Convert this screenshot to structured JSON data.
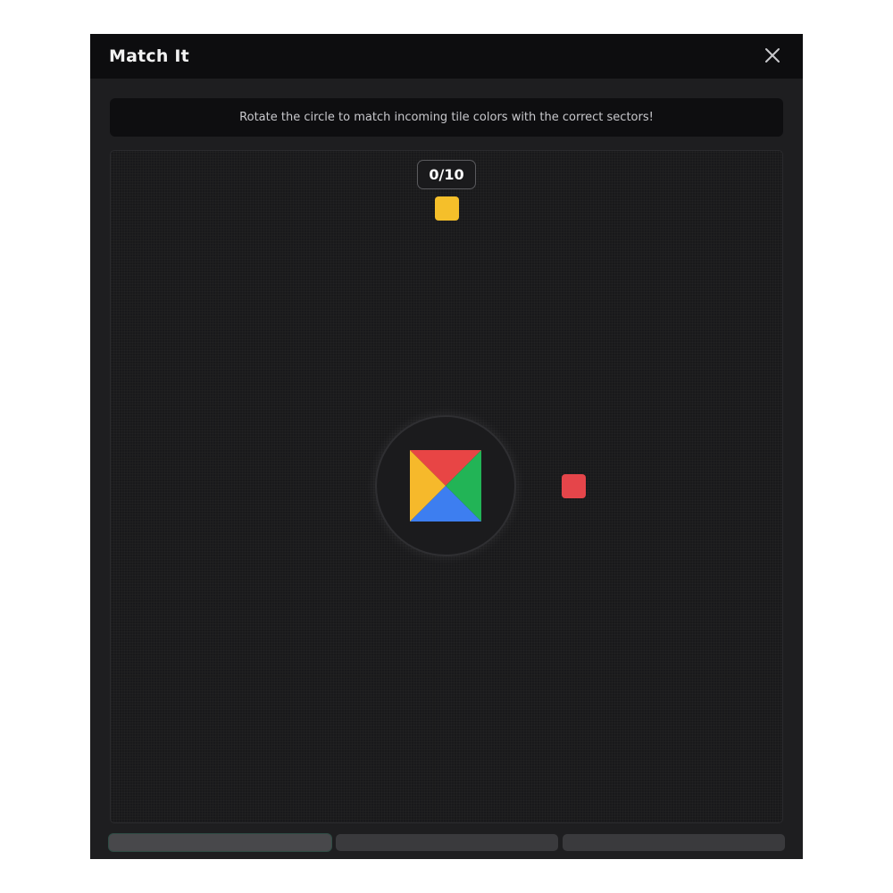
{
  "window": {
    "title": "Match It",
    "close_icon": "close-icon"
  },
  "instructions": "Rotate the circle to match incoming tile colors with the correct sectors!",
  "game": {
    "score": "0/10",
    "incoming_tiles": [
      {
        "color": "#f5bf2a",
        "direction": "top"
      },
      {
        "color": "#e5454a",
        "direction": "right"
      }
    ],
    "wheel_sectors": {
      "top": "#e84545",
      "right": "#22b456",
      "bottom": "#3d7ef0",
      "left": "#f6b92b"
    }
  },
  "progress": {
    "stages_total": 3,
    "current_stage": 1
  }
}
